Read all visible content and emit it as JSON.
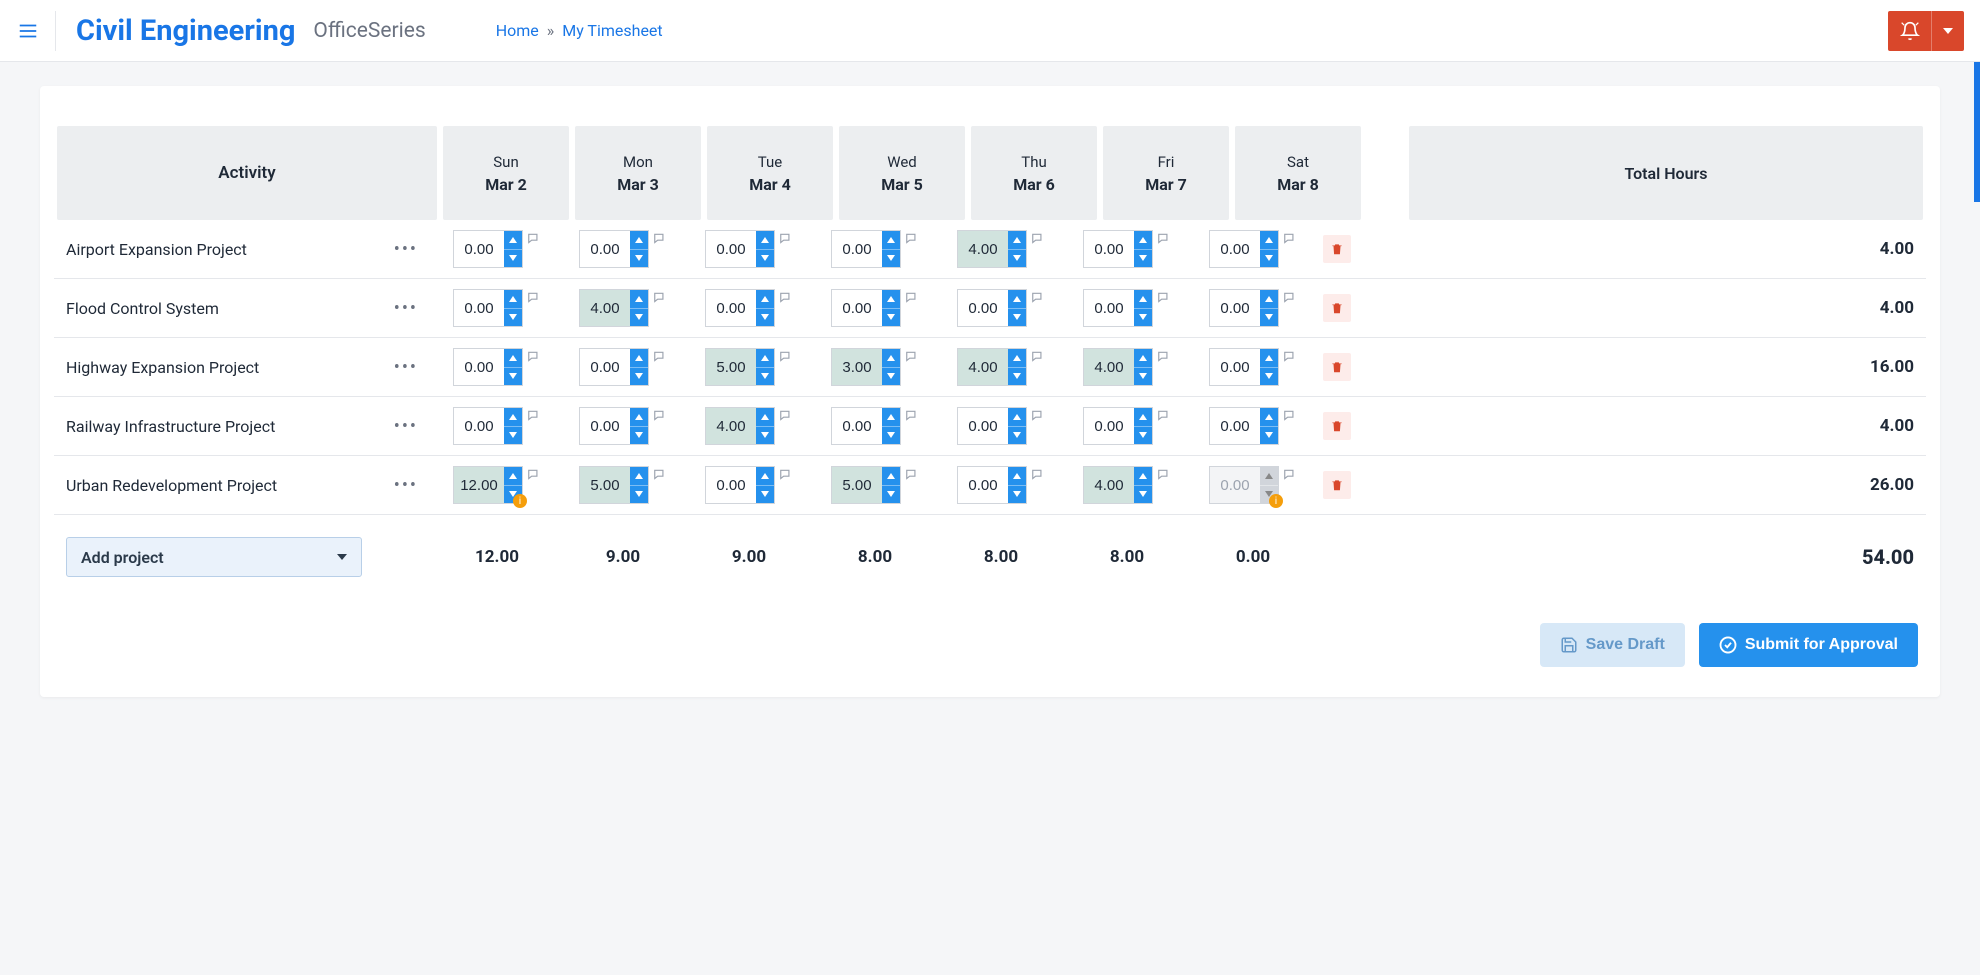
{
  "header": {
    "title": "Civil Engineering",
    "subtitle": "OfficeSeries",
    "breadcrumb_home": "Home",
    "breadcrumb_current": "My Timesheet"
  },
  "table": {
    "activity_header": "Activity",
    "total_header": "Total Hours",
    "days": [
      {
        "name": "Sun",
        "date": "Mar 2"
      },
      {
        "name": "Mon",
        "date": "Mar 3"
      },
      {
        "name": "Tue",
        "date": "Mar 4"
      },
      {
        "name": "Wed",
        "date": "Mar 5"
      },
      {
        "name": "Thu",
        "date": "Mar 6"
      },
      {
        "name": "Fri",
        "date": "Mar 7"
      },
      {
        "name": "Sat",
        "date": "Mar 8"
      }
    ],
    "rows": [
      {
        "name": "Airport Expansion Project",
        "cells": [
          {
            "val": "0.00",
            "filled": false
          },
          {
            "val": "0.00",
            "filled": false
          },
          {
            "val": "0.00",
            "filled": false
          },
          {
            "val": "0.00",
            "filled": false
          },
          {
            "val": "4.00",
            "filled": true
          },
          {
            "val": "0.00",
            "filled": false
          },
          {
            "val": "0.00",
            "filled": false
          }
        ],
        "total": "4.00"
      },
      {
        "name": "Flood Control System",
        "cells": [
          {
            "val": "0.00",
            "filled": false
          },
          {
            "val": "4.00",
            "filled": true
          },
          {
            "val": "0.00",
            "filled": false
          },
          {
            "val": "0.00",
            "filled": false
          },
          {
            "val": "0.00",
            "filled": false
          },
          {
            "val": "0.00",
            "filled": false
          },
          {
            "val": "0.00",
            "filled": false
          }
        ],
        "total": "4.00"
      },
      {
        "name": "Highway Expansion Project",
        "cells": [
          {
            "val": "0.00",
            "filled": false
          },
          {
            "val": "0.00",
            "filled": false
          },
          {
            "val": "5.00",
            "filled": true
          },
          {
            "val": "3.00",
            "filled": true
          },
          {
            "val": "4.00",
            "filled": true
          },
          {
            "val": "4.00",
            "filled": true
          },
          {
            "val": "0.00",
            "filled": false
          }
        ],
        "total": "16.00"
      },
      {
        "name": "Railway Infrastructure Project",
        "cells": [
          {
            "val": "0.00",
            "filled": false
          },
          {
            "val": "0.00",
            "filled": false
          },
          {
            "val": "4.00",
            "filled": true
          },
          {
            "val": "0.00",
            "filled": false
          },
          {
            "val": "0.00",
            "filled": false
          },
          {
            "val": "0.00",
            "filled": false
          },
          {
            "val": "0.00",
            "filled": false
          }
        ],
        "total": "4.00"
      },
      {
        "name": "Urban Redevelopment Project",
        "cells": [
          {
            "val": "12.00",
            "filled": true,
            "info": true
          },
          {
            "val": "5.00",
            "filled": true
          },
          {
            "val": "0.00",
            "filled": false
          },
          {
            "val": "5.00",
            "filled": true
          },
          {
            "val": "0.00",
            "filled": false
          },
          {
            "val": "4.00",
            "filled": true
          },
          {
            "val": "0.00",
            "filled": false,
            "disabled": true,
            "info": true
          }
        ],
        "total": "26.00"
      }
    ],
    "add_project_label": "Add project",
    "day_totals": [
      "12.00",
      "9.00",
      "9.00",
      "8.00",
      "8.00",
      "8.00",
      "0.00"
    ],
    "grand_total": "54.00"
  },
  "footer": {
    "save_draft": "Save Draft",
    "submit": "Submit for Approval"
  }
}
